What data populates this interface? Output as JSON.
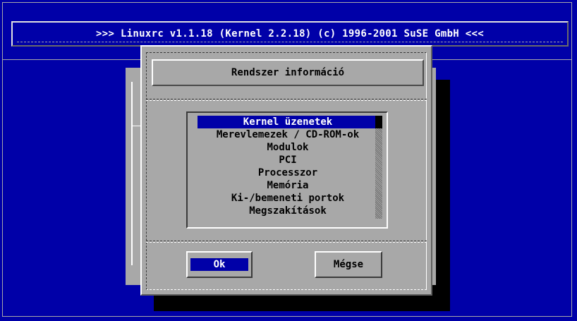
{
  "header": {
    "title": ">>> Linuxrc v1.1.18 (Kernel 2.2.18) (c) 1996-2001 SuSE GmbH <<<"
  },
  "dialog": {
    "title": "Rendszer információ",
    "selected_index": 0,
    "items": [
      {
        "label": "Kernel üzenetek"
      },
      {
        "label": "Merevlemezek / CD-ROM-ok"
      },
      {
        "label": "Modulok"
      },
      {
        "label": "PCI"
      },
      {
        "label": "Processzor"
      },
      {
        "label": "Memória"
      },
      {
        "label": "Ki-/bemeneti portok"
      },
      {
        "label": "Megszakítások"
      }
    ],
    "buttons": {
      "ok": "Ok",
      "cancel": "Mégse"
    }
  },
  "colors": {
    "background": "#0000a8",
    "dialog": "#a8a8a8",
    "highlight": "#0000a8",
    "text": "#000000",
    "header_text": "#ffffff"
  }
}
